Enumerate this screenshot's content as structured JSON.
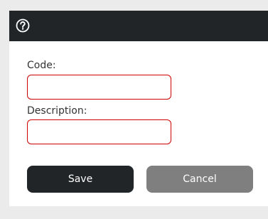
{
  "titlebar": {
    "icon": "help-circle-icon"
  },
  "form": {
    "code_label": "Code:",
    "code_value": "",
    "description_label": "Description:",
    "description_value": ""
  },
  "buttons": {
    "save_label": "Save",
    "cancel_label": "Cancel"
  },
  "colors": {
    "titlebar_bg": "#222528",
    "invalid_border": "#cc0000",
    "save_bg": "#222528",
    "cancel_bg": "#7f7f7f"
  }
}
